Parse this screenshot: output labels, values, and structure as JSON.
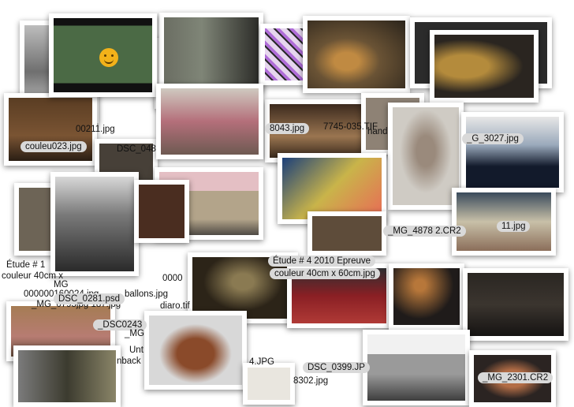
{
  "labels": {
    "l1": "00211.jpg",
    "l2": "couleu023.jpg",
    "l3": "DSC_048",
    "l4": "8043.jpg",
    "l5": "7745-035.TIF",
    "l6": "hand",
    "l7": "_G_3027.jpg",
    "l8": "_MG_4878 2.CR2",
    "l9": "11.jpg",
    "l10": "Étude # 1",
    "l11": "couleur 40cm x",
    "l12": "Étude # 4 2010 Epreuve",
    "l13": "couleur 40cm x 60cm.jpg",
    "l14": "0000",
    "l15": "MG",
    "l16": "000000160024.jpg",
    "l17": "_MG_0795jpg 187.jpg",
    "l18": "DSC_0281.psd",
    "l19": "ballons.jpg",
    "l20": "diaro.tif",
    "l21": "_DSC0243",
    "l22": "_MG",
    "l23": "Unt",
    "l24": "nback",
    "l25": "4.JPG",
    "l26": "DSC_0399.JP",
    "l27": "8302.jpg",
    "l28": "_MG_2301.CR2"
  },
  "photo_colors": {
    "train": "#3f5f3a",
    "grafitti": "#c9c0d6",
    "bakery": "#5a4a34",
    "portrait_wall": "#332f28",
    "market": "#7a6f62",
    "street_dark": "#2d2a28"
  }
}
